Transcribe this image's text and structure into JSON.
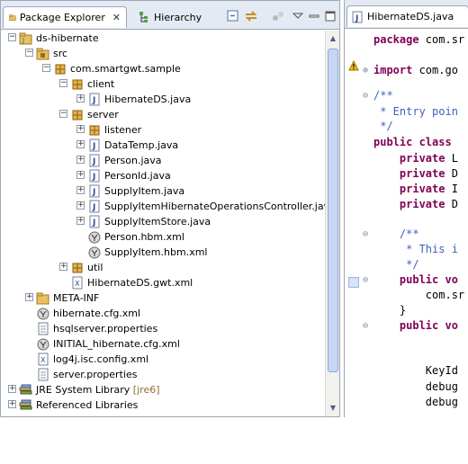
{
  "left_panel": {
    "tabs": [
      {
        "label": "Package Explorer",
        "close": "✕"
      },
      {
        "label": "Hierarchy"
      }
    ],
    "toolbar_icons": [
      "collapse-all-icon",
      "link-editor-icon",
      "focus-icon",
      "view-menu-icon",
      "minimize-icon",
      "maximize-icon"
    ]
  },
  "tree": [
    {
      "label": "ds-hibernate",
      "icon": "project-icon",
      "toggle": "−",
      "name": "tree-item-ds-hibernate"
    },
    {
      "label": "src",
      "icon": "source-folder-icon",
      "toggle": "−",
      "name": "tree-item-src"
    },
    {
      "label": "com.smartgwt.sample",
      "icon": "package-icon",
      "toggle": "−",
      "name": "tree-item-com-smartgwt-sample"
    },
    {
      "label": "client",
      "icon": "package-icon",
      "toggle": "−",
      "name": "tree-item-client"
    },
    {
      "label": "HibernateDS.java",
      "icon": "java-file-icon",
      "toggle": "+",
      "name": "tree-item-hibernateds-java"
    },
    {
      "label": "server",
      "icon": "package-icon",
      "toggle": "−",
      "name": "tree-item-server"
    },
    {
      "label": "listener",
      "icon": "package-icon",
      "toggle": "+",
      "name": "tree-item-listener"
    },
    {
      "label": "DataTemp.java",
      "icon": "java-file-icon",
      "toggle": "+",
      "name": "tree-item-datatemp-java"
    },
    {
      "label": "Person.java",
      "icon": "java-file-icon",
      "toggle": "+",
      "name": "tree-item-person-java"
    },
    {
      "label": "PersonId.java",
      "icon": "java-file-icon",
      "toggle": "+",
      "name": "tree-item-personid-java"
    },
    {
      "label": "SupplyItem.java",
      "icon": "java-file-icon",
      "toggle": "+",
      "name": "tree-item-supplyitem-java"
    },
    {
      "label": "SupplyItemHibernateOperationsController.java",
      "icon": "java-file-icon",
      "toggle": "+",
      "name": "tree-item-supplyitemhibernateoperationscontroller-java"
    },
    {
      "label": "SupplyItemStore.java",
      "icon": "java-file-icon",
      "toggle": "+",
      "name": "tree-item-supplyitemstore-java"
    },
    {
      "label": "Person.hbm.xml",
      "icon": "hibernate-xml-icon",
      "toggle": "",
      "name": "tree-item-person-hbm-xml"
    },
    {
      "label": "SupplyItem.hbm.xml",
      "icon": "hibernate-xml-icon",
      "toggle": "",
      "name": "tree-item-supplyitem-hbm-xml"
    },
    {
      "label": "util",
      "icon": "package-icon",
      "toggle": "+",
      "name": "tree-item-util"
    },
    {
      "label": "HibernateDS.gwt.xml",
      "icon": "xml-file-icon",
      "toggle": "",
      "name": "tree-item-hibernateds-gwt-xml"
    },
    {
      "label": "META-INF",
      "icon": "folder-icon",
      "toggle": "+",
      "name": "tree-item-meta-inf"
    },
    {
      "label": "hibernate.cfg.xml",
      "icon": "hibernate-xml-icon",
      "toggle": "",
      "name": "tree-item-hibernate-cfg-xml"
    },
    {
      "label": "hsqlserver.properties",
      "icon": "text-file-icon",
      "toggle": "",
      "name": "tree-item-hsqlserver-properties"
    },
    {
      "label": "INITIAL_hibernate.cfg.xml",
      "icon": "hibernate-xml-icon",
      "toggle": "",
      "name": "tree-item-initial-hibernate-cfg-xml"
    },
    {
      "label": "log4j.isc.config.xml",
      "icon": "xml-file-icon",
      "toggle": "",
      "name": "tree-item-log4j-isc-config-xml"
    },
    {
      "label": "server.properties",
      "icon": "text-file-icon",
      "toggle": "",
      "name": "tree-item-server-properties"
    },
    {
      "label": "JRE System Library",
      "decoration": "[jre6]",
      "icon": "library-icon",
      "toggle": "+",
      "name": "tree-item-jre-system-library"
    },
    {
      "label": "Referenced Libraries",
      "icon": "library-icon",
      "toggle": "+",
      "name": "tree-item-referenced-libraries"
    }
  ],
  "editor": {
    "tab_label": "HibernateDS.java",
    "lines": [
      {
        "parts": [
          {
            "t": "package",
            "c": "kw"
          },
          {
            "t": " com.sr",
            "c": ""
          }
        ],
        "name": "code-line-package"
      },
      {
        "parts": [
          {
            "t": "import",
            "c": "kw"
          },
          {
            "t": " com.go",
            "c": ""
          }
        ],
        "name": "code-line-import"
      },
      {
        "parts": [
          {
            "t": "/**",
            "c": "cm"
          }
        ],
        "name": "code-line-javadoc-open"
      },
      {
        "parts": [
          {
            "t": " * Entry poin",
            "c": "cm"
          }
        ],
        "name": "code-line-entry-point"
      },
      {
        "parts": [
          {
            "t": " */",
            "c": "cm"
          }
        ],
        "name": "code-line-javadoc-close"
      },
      {
        "parts": [
          {
            "t": "public class ",
            "c": "kw"
          }
        ],
        "name": "code-line-class"
      },
      {
        "parts": [
          {
            "t": "    private",
            "c": "kw"
          },
          {
            "t": " L",
            "c": ""
          }
        ],
        "name": "code-line-field-1"
      },
      {
        "parts": [
          {
            "t": "    private",
            "c": "kw"
          },
          {
            "t": " D",
            "c": ""
          }
        ],
        "name": "code-line-field-2"
      },
      {
        "parts": [
          {
            "t": "    private",
            "c": "kw"
          },
          {
            "t": " I",
            "c": ""
          }
        ],
        "name": "code-line-field-3"
      },
      {
        "parts": [
          {
            "t": "    private",
            "c": "kw"
          },
          {
            "t": " D",
            "c": ""
          }
        ],
        "name": "code-line-field-4"
      },
      {
        "parts": [
          {
            "t": "    /**",
            "c": "cm"
          }
        ],
        "name": "code-line-doc2-open"
      },
      {
        "parts": [
          {
            "t": "     * This i",
            "c": "cm"
          }
        ],
        "name": "code-line-this-is"
      },
      {
        "parts": [
          {
            "t": "     */",
            "c": "cm"
          }
        ],
        "name": "code-line-doc2-close"
      },
      {
        "parts": [
          {
            "t": "    public vo",
            "c": "kw"
          }
        ],
        "name": "code-line-method-1"
      },
      {
        "parts": [
          {
            "t": "        com.sr",
            "c": ""
          }
        ],
        "name": "code-line-body-1"
      },
      {
        "parts": [
          {
            "t": "    }",
            "c": ""
          }
        ],
        "name": "code-line-close-1"
      },
      {
        "parts": [
          {
            "t": "    public vo",
            "c": "kw"
          }
        ],
        "name": "code-line-method-2"
      },
      {
        "parts": [
          {
            "t": "        KeyId",
            "c": ""
          }
        ],
        "name": "code-line-keyid"
      },
      {
        "parts": [
          {
            "t": "        debug",
            "c": ""
          }
        ],
        "name": "code-line-debug-1"
      },
      {
        "parts": [
          {
            "t": "        debug",
            "c": ""
          }
        ],
        "name": "code-line-debug-2"
      }
    ]
  }
}
